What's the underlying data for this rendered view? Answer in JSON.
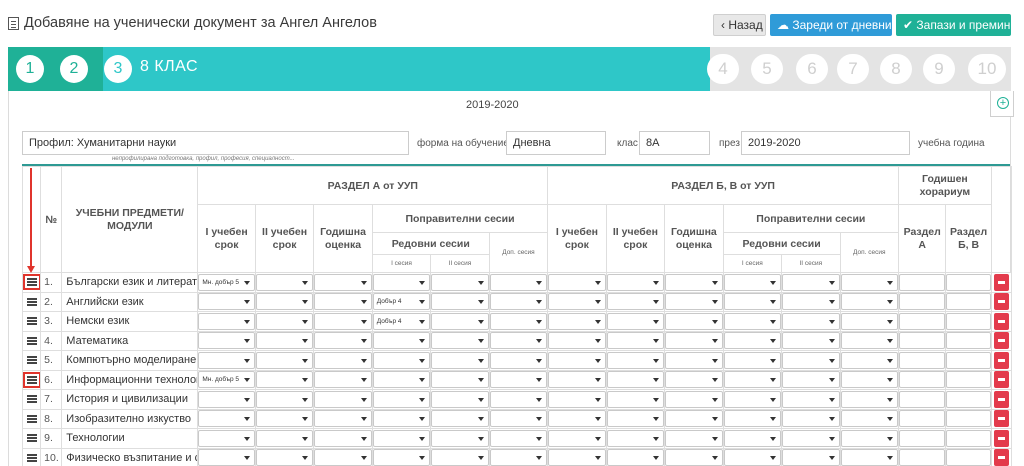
{
  "header": {
    "title": "Добавяне на ученически документ за Ангел Ангелов",
    "back_label": "‹ Назад",
    "load_label": "Зареди от дневник",
    "save_label": "Запази и премини"
  },
  "steps": {
    "items": [
      "1",
      "2",
      "3",
      "4",
      "5",
      "6",
      "7",
      "8",
      "9",
      "10"
    ],
    "active_label": "8 КЛАС",
    "active_index": 3
  },
  "form": {
    "year_heading": "2019-2020",
    "profile_value": "Профил: Хуманитарни науки",
    "profile_hint": "непрофилирана подготовка, профил, професия, специалност...",
    "form_label": "форма на обучение",
    "form_value": "Дневна",
    "class_label": "клас",
    "class_value": "8А",
    "period_label": "през",
    "period_value": "2019-2020",
    "year_label": "учебна година"
  },
  "table": {
    "col_num": "№",
    "col_subjects": "УЧЕБНИ ПРЕДМЕТИ/ МОДУЛИ",
    "section_a": "РАЗДЕЛ А от УУП",
    "section_b": "РАЗДЕЛ Б, В от УУП",
    "annual_hours": "Годишен хорариум",
    "term1": "I учебен срок",
    "term2": "II учебен срок",
    "annual_grade": "Годишна оценка",
    "makeup_sessions": "Поправителни сесии",
    "regular_sessions": "Редовни сесии",
    "extra_session": "Доп. сесия",
    "session1": "I сесия",
    "session2": "II сесия",
    "hours_a": "Раздел А",
    "hours_bv": "Раздел Б, В",
    "rows": [
      {
        "num": "1.",
        "subject": "Български език и литература",
        "term1": "Мн. добър 5",
        "s1": ""
      },
      {
        "num": "2.",
        "subject": "Английски език",
        "term1": "",
        "s1": "Добър 4"
      },
      {
        "num": "3.",
        "subject": "Немски език",
        "term1": "",
        "s1": "Добър 4"
      },
      {
        "num": "4.",
        "subject": "Математика",
        "term1": "",
        "s1": ""
      },
      {
        "num": "5.",
        "subject": "Компютърно моделиране",
        "term1": "",
        "s1": ""
      },
      {
        "num": "6.",
        "subject": "Информационни технологии",
        "term1": "Мн. добър 5",
        "s1": ""
      },
      {
        "num": "7.",
        "subject": "История и цивилизации",
        "term1": "",
        "s1": ""
      },
      {
        "num": "8.",
        "subject": "Изобразително изкуство",
        "term1": "",
        "s1": ""
      },
      {
        "num": "9.",
        "subject": "Технологии",
        "term1": "",
        "s1": ""
      },
      {
        "num": "10.",
        "subject": "Физическо възпитание и спорт",
        "term1": "",
        "s1": ""
      }
    ]
  },
  "colors": {
    "teal": "#1fb197",
    "cyan": "#2ec7c8",
    "blue": "#2f9bd8",
    "danger": "#e33b4c",
    "annotation_red": "#e0342c"
  }
}
